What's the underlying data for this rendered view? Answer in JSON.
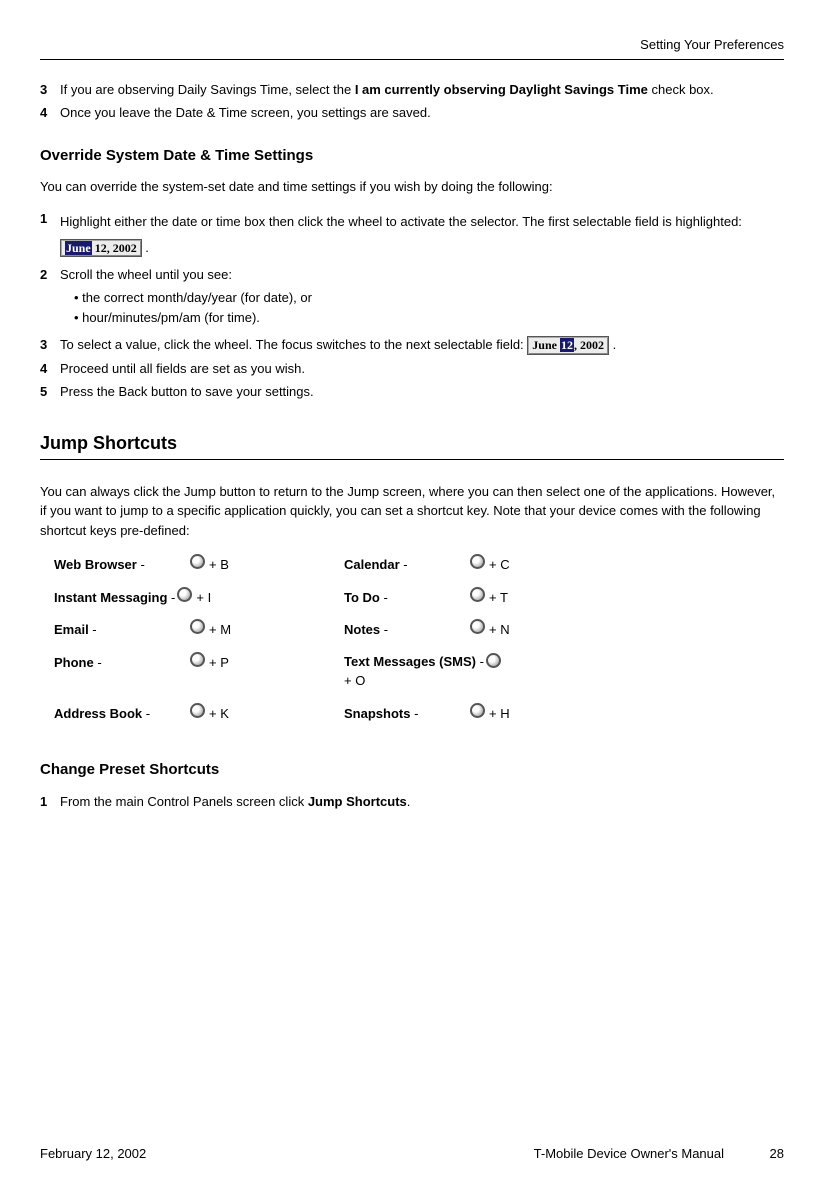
{
  "header": {
    "title": "Setting Your Preferences"
  },
  "dst": {
    "steps": {
      "s3n": "3",
      "s3a": "If you are observing Daily Savings Time, select the ",
      "s3b": "I am currently observing Daylight Savings Time",
      "s3c": " check box.",
      "s4n": "4",
      "s4": "Once you leave the Date & Time screen, you settings are saved."
    }
  },
  "override": {
    "heading": "Override System Date & Time Settings",
    "intro": "You can override the system-set date and time settings if you wish by doing the following:",
    "steps": {
      "s1n": "1",
      "s1a": "Highlight either the date or time box then click the wheel to activate the selector. The first selectable field is highlighted: ",
      "pill1a": "June",
      "pill1b": " 12, 2002",
      "dot": " .",
      "s2n": "2",
      "s2": "Scroll the wheel until you see:",
      "b1": "•  the correct month/day/year (for date), or",
      "b2": "•  hour/minutes/pm/am (for time).",
      "s3n": "3",
      "s3a": "To select a value, click the wheel. The focus switches to the next selectable field: ",
      "pill2a": "June ",
      "pill2b": "12",
      "pill2c": ", 2002",
      "s4n": "4",
      "s4": "Proceed until all fields are set as you wish.",
      "s5n": "5",
      "s5": "Press the Back button to save your settings."
    }
  },
  "jump": {
    "heading": "Jump Shortcuts",
    "intro": "You can always click the Jump button to return to the Jump screen, where you can then select one of the applications. However, if you want to jump to a specific application quickly, you can set a shortcut key. Note that your device comes with the following shortcut keys pre-defined:",
    "sc": {
      "web": "Web Browser",
      "web_d": " - ",
      "web_k": " + B",
      "cal": "Calendar",
      "cal_d": " -",
      "cal_k": " + C",
      "im": "Instant Messaging",
      "im_d": " - ",
      "im_k": " + I",
      "todo": "To Do",
      "todo_d": " -",
      "todo_k": " + T",
      "email": "Email",
      "email_d": " -",
      "email_k": " + M",
      "notes": "Notes",
      "notes_d": " -",
      "notes_k": " + N",
      "phone": "Phone",
      "phone_d": " -",
      "phone_k": " + P",
      "sms": "Text Messages (SMS)",
      "sms_d": " - ",
      "sms_k": "+ O",
      "ab": "Address Book",
      "ab_d": " - ",
      "ab_k": " + K",
      "snap": "Snapshots",
      "snap_d": " -",
      "snap_k": " + H"
    }
  },
  "preset": {
    "heading": "Change Preset Shortcuts",
    "s1n": "1",
    "s1a": "From the main Control Panels screen click ",
    "s1b": "Jump Shortcuts",
    "s1c": "."
  },
  "footer": {
    "date": "February 12, 2002",
    "title": "T-Mobile Device Owner's Manual",
    "page": "28"
  }
}
